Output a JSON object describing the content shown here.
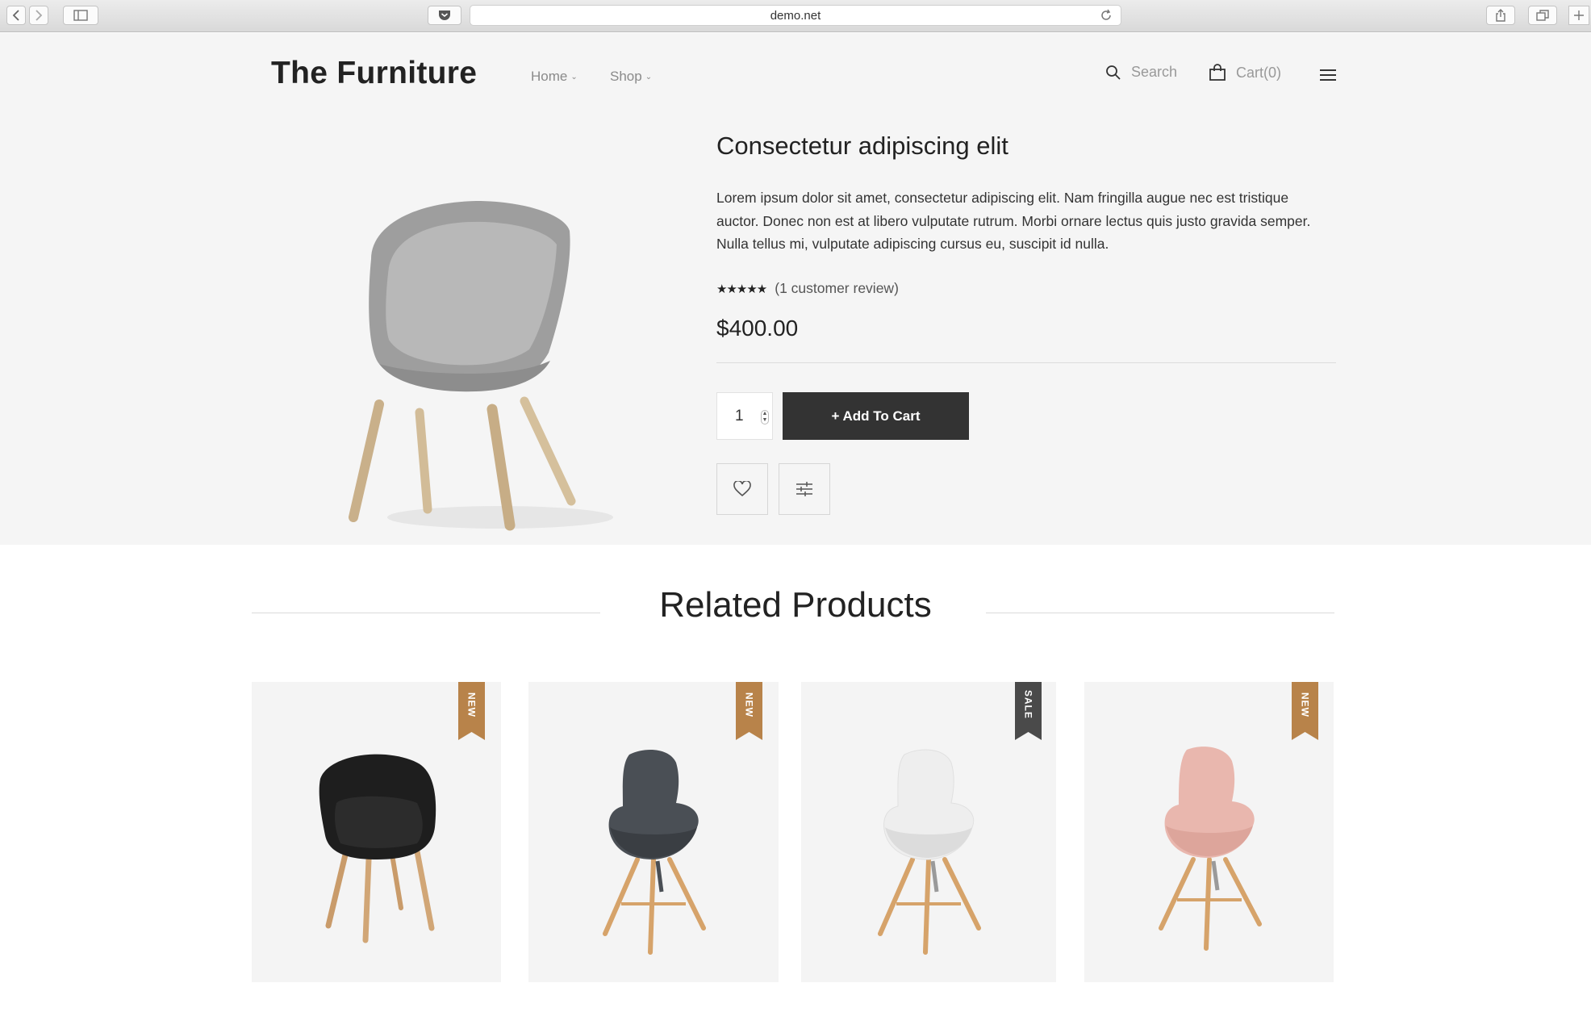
{
  "browser": {
    "url": "demo.net"
  },
  "header": {
    "logo": "The Furniture",
    "nav": [
      {
        "label": "Home"
      },
      {
        "label": "Shop"
      }
    ],
    "search_label": "Search",
    "cart_label": "Cart(0)"
  },
  "product": {
    "title": "Consectetur adipiscing elit",
    "description": "Lorem ipsum dolor sit amet, consectetur adipiscing elit. Nam fringilla augue nec est tristique auctor. Donec non est at libero vulputate rutrum. Morbi ornare lectus quis justo gravida semper. Nulla tellus mi, vulputate adipiscing cursus eu, suscipit id nulla.",
    "rating_stars": 5,
    "stars_text": "★★★★★",
    "reviews": "(1 customer review)",
    "price": "$400.00",
    "quantity": "1",
    "add_to_cart": "+ Add To Cart"
  },
  "related": {
    "title": "Related Products",
    "items": [
      {
        "badge": "NEW",
        "badge_color": "#b8834a",
        "chair_color": "#1e1e1e",
        "icon": "black-chair-image"
      },
      {
        "badge": "NEW",
        "badge_color": "#b8834a",
        "chair_color": "#4a4f55",
        "icon": "grey-armchair-image"
      },
      {
        "badge": "SALE",
        "badge_color": "#4a4a4a",
        "chair_color": "#eeeeee",
        "icon": "white-armchair-image"
      },
      {
        "badge": "NEW",
        "badge_color": "#b8834a",
        "chair_color": "#e9b7ae",
        "icon": "pink-armchair-image"
      }
    ]
  },
  "colors": {
    "hero_bg": "#f5f5f5",
    "button_dark": "#333333",
    "badge_new": "#b8834a",
    "badge_sale": "#4a4a4a"
  }
}
